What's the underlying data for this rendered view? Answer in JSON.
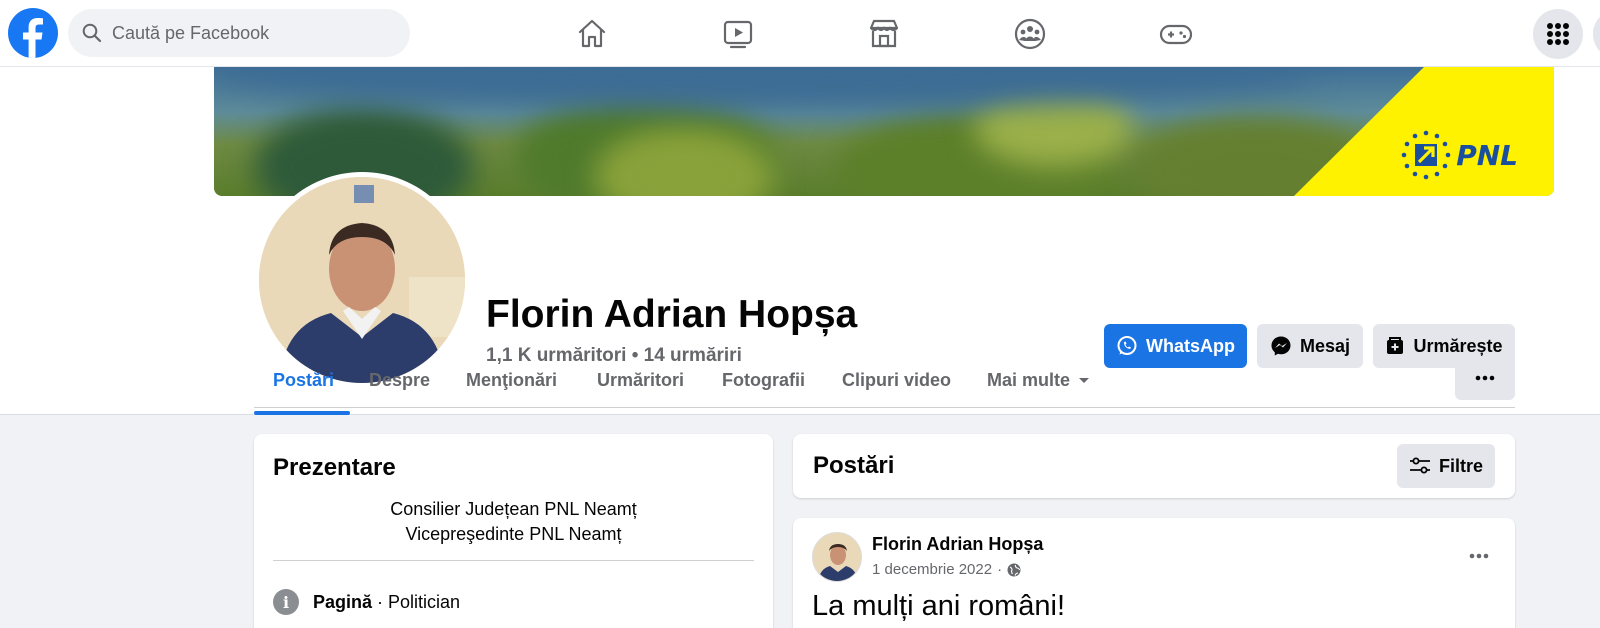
{
  "topbar": {
    "search_placeholder": "Caută pe Facebook",
    "nav_icons": [
      "home-icon",
      "video-icon",
      "marketplace-icon",
      "groups-icon",
      "gaming-icon"
    ]
  },
  "profile": {
    "name": "Florin Adrian Hopșa",
    "stats": "1,1 K urmăritori • 14 urmăriri",
    "cover_logo_text": "PNL",
    "buttons": {
      "whatsapp": "WhatsApp",
      "message": "Mesaj",
      "follow": "Urmărește"
    },
    "tabs": [
      {
        "label": "Postări",
        "active": true
      },
      {
        "label": "Despre",
        "active": false
      },
      {
        "label": "Menţionări",
        "active": false
      },
      {
        "label": "Urmăritori",
        "active": false
      },
      {
        "label": "Fotografii",
        "active": false
      },
      {
        "label": "Clipuri video",
        "active": false
      },
      {
        "label": "Mai multe",
        "active": false
      }
    ]
  },
  "intro": {
    "title": "Prezentare",
    "bio_line1": "Consilier Județean PNL Neamț",
    "bio_line2": "Vicepreşedinte PNL Neamț",
    "category_label": "Pagină",
    "category_value": " · Politician"
  },
  "posts": {
    "title": "Postări",
    "filters_label": "Filtre",
    "items": [
      {
        "author": "Florin Adrian Hopșa",
        "date": "1 decembrie 2022",
        "separator": "·",
        "text": "La mulți ani români!"
      }
    ]
  },
  "colors": {
    "brand_blue": "#1877f2",
    "active_tab": "#1b74e4",
    "pnl_yellow": "#fff200",
    "pnl_blue": "#1a4fa0"
  }
}
